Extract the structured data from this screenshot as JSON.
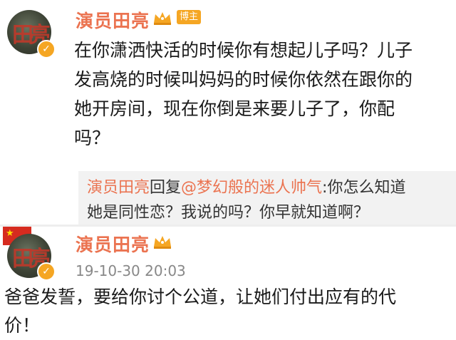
{
  "post1": {
    "username": "演员田亮",
    "badge": "博主",
    "avatar_text": "田亮",
    "text_lines": [
      "在你潇洒快活的时候你有想起儿子吗？儿子",
      "发高烧的时候叫妈妈的时候你依然在跟你的",
      "她开房间，现在你倒是来要儿子了，你配",
      "吗？"
    ],
    "reply": {
      "author": "演员田亮",
      "action": "回复",
      "mention": "@梦幻般的迷人帅气",
      "text_line1": ":你怎么知道",
      "text_line2": "她是同性恋？我说的吗？你早就知道啊？"
    }
  },
  "post2": {
    "username": "演员田亮",
    "avatar_text": "田亮",
    "timestamp": "19-10-30 20:03",
    "text_lines": [
      "爸爸发誓，要给你讨个公道，让她们付出应有的代",
      "价！"
    ]
  },
  "colors": {
    "username": "#eb7350",
    "badge": "#f5a623",
    "reply_bg": "#f2f2f2"
  },
  "icons": [
    "verified-icon",
    "crown-icon",
    "china-flag-icon"
  ]
}
